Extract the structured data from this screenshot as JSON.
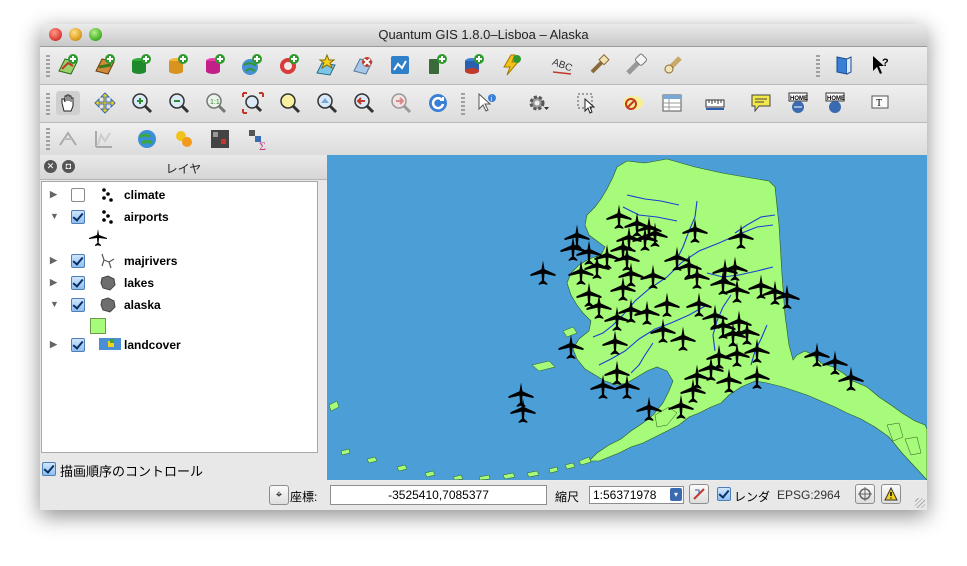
{
  "window": {
    "title": "Quantum GIS 1.8.0–Lisboa – Alaska"
  },
  "toolbar1": {
    "icons": [
      "add-vector-layer-icon",
      "add-raster-layer-icon",
      "add-postgis-layer-icon",
      "add-spatialite-layer-icon",
      "add-mssql-layer-icon",
      "add-wms-layer-icon",
      "add-wcs-layer-icon",
      "remove-layer-icon",
      "new-shapefile-icon",
      "new-spatialite-layer-icon",
      "add-gps-layer-icon",
      "add-wfs-layer-icon",
      "label-icon",
      "pin-label-icon",
      "move-label-icon",
      "change-label-icon",
      "help-book-icon",
      "whats-this-icon"
    ]
  },
  "toolbar2": {
    "icons": [
      "pan-icon",
      "pan-to-selection-icon",
      "zoom-in-icon",
      "zoom-out-icon",
      "zoom-actual-size-icon",
      "zoom-full-icon",
      "zoom-to-selection-icon",
      "zoom-to-layer-icon",
      "zoom-last-icon",
      "zoom-next-icon",
      "refresh-icon",
      "identify-icon",
      "actions-icon",
      "select-icon",
      "deselect-icon",
      "attribute-table-icon",
      "measure-icon",
      "map-tips-icon",
      "new-bookmark-icon",
      "show-bookmarks-icon",
      "text-annotation-icon"
    ]
  },
  "toolbar3": {
    "icons": [
      "spatial-query-icon",
      "profile-icon",
      "georeferencer-icon",
      "heatmap-icon",
      "raster-calculator-icon",
      "zonal-statistics-icon"
    ]
  },
  "panel": {
    "title": "レイヤ",
    "layers": [
      {
        "name": "climate",
        "checked": false,
        "expanded": false,
        "icon": "point-layer-icon"
      },
      {
        "name": "airports",
        "checked": true,
        "expanded": true,
        "icon": "point-layer-icon",
        "legend_icon": "airplane-symbol-icon"
      },
      {
        "name": "majrivers",
        "checked": true,
        "expanded": false,
        "icon": "line-layer-icon"
      },
      {
        "name": "lakes",
        "checked": true,
        "expanded": false,
        "icon": "polygon-layer-icon"
      },
      {
        "name": "alaska",
        "checked": true,
        "expanded": true,
        "icon": "polygon-layer-icon",
        "legend_color": "#a6fb7a"
      },
      {
        "name": "landcover",
        "checked": true,
        "expanded": false,
        "icon": "raster-layer-icon"
      }
    ],
    "render_order_label": "描画順序のコントロール",
    "render_order_checked": true
  },
  "map": {
    "background_color": "#4b9ed6",
    "land_color": "#a6fb7a",
    "river_color": "#1a3fd6",
    "airport_color": "#000000"
  },
  "status": {
    "coord_label": "座標:",
    "coord_value": "-3525410,7085377",
    "scale_label": "縮尺",
    "scale_value": "1:56371978",
    "render_label": "レンダ",
    "render_checked": true,
    "crs": "EPSG:2964"
  }
}
